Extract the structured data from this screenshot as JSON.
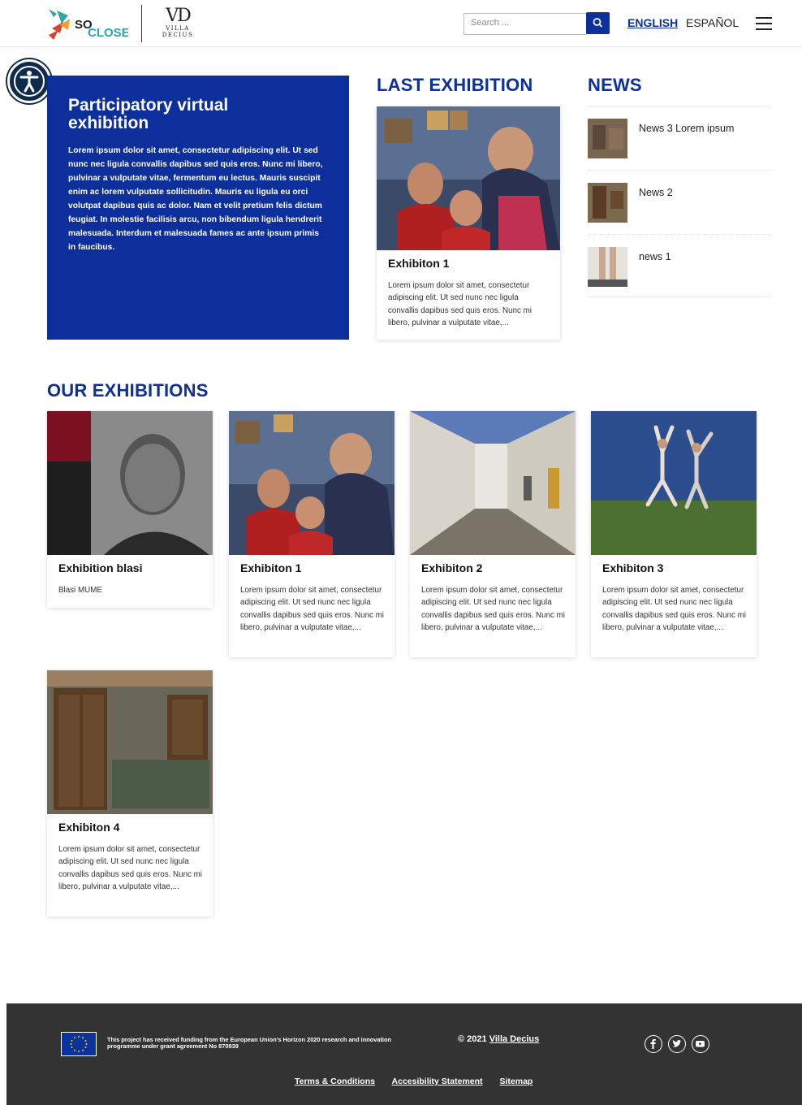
{
  "header": {
    "logo_so": "SO",
    "logo_close": "CLOSE",
    "logo_vd_mark": "VD",
    "logo_vd_line1": "VILLA",
    "logo_vd_line2": "DECIUS",
    "search_placeholder": "Search ...",
    "lang_active": "ENGLISH",
    "lang_other": "ESPAÑOL"
  },
  "hero": {
    "title": "Participatory virtual exhibition",
    "text": "Lorem ipsum dolor sit amet, consectetur adipiscing elit. Ut sed nunc nec ligula convallis dapibus sed quis eros. Nunc mi libero, pulvinar a vulputate vitae, fermentum eu lectus. Mauris suscipit enim ac lorem vulputate sollicitudin. Mauris eu ligula eu orci volutpat dapibus quis ac dolor. Nam et velit pretium felis dictum feugiat. In molestie facilisis arcu, non bibendum ligula hendrerit malesuada. Interdum et malesuada fames ac ante ipsum primis in faucibus."
  },
  "last_exhibition": {
    "heading": "LAST EXHIBITION",
    "title": "Exhibiton 1",
    "text": "Lorem ipsum dolor sit amet, consectetur adipiscing elit. Ut sed nunc nec ligula convallis dapibus sed quis eros. Nunc mi libero, pulvinar a vulputate vitae,..."
  },
  "news": {
    "heading": "NEWS",
    "items": [
      {
        "label": "News 3 Lorem ipsum"
      },
      {
        "label": "News 2"
      },
      {
        "label": "news 1"
      }
    ]
  },
  "our_exhibitions": {
    "heading": "OUR EXHIBITIONS",
    "cards": [
      {
        "title": "Exhibition blasi",
        "text": "Blasi MUME"
      },
      {
        "title": "Exhibiton 1",
        "text": "Lorem ipsum dolor sit amet, consectetur adipiscing elit. Ut sed nunc nec ligula convallis dapibus sed quis eros. Nunc mi libero, pulvinar a vulputate vitae,..."
      },
      {
        "title": "Exhibiton 2",
        "text": "Lorem ipsum dolor sit amet, consectetur adipiscing elit. Ut sed nunc nec ligula convallis dapibus sed quis eros. Nunc mi libero, pulvinar a vulputate vitae,..."
      },
      {
        "title": "Exhibiton 3",
        "text": "Lorem ipsum dolor sit amet, consectetur adipiscing elit. Ut sed nunc nec ligula convallis dapibus sed quis eros. Nunc mi libero, pulvinar a vulputate vitae,..."
      },
      {
        "title": "Exhibiton 4",
        "text": "Lorem ipsum dolor sit amet, consectetur adipiscing elit. Ut sed nunc nec ligula convallis dapibus sed quis eros. Nunc mi libero, pulvinar a vulputate vitae,..."
      }
    ]
  },
  "footer": {
    "funding": "This project has received funding from the European Union's Horizon 2020 research and innovation programme under grant agreement No 870939",
    "copyright_prefix": "© 2021",
    "copyright_link": "Villa Decius",
    "links": [
      "Terms & Conditions",
      "Accesibility Statement",
      "Sitemap"
    ]
  },
  "colors": {
    "brand_blue": "#0c2f9c",
    "footer_bg": "#333333",
    "logo_teal": "#2aa8a8"
  }
}
